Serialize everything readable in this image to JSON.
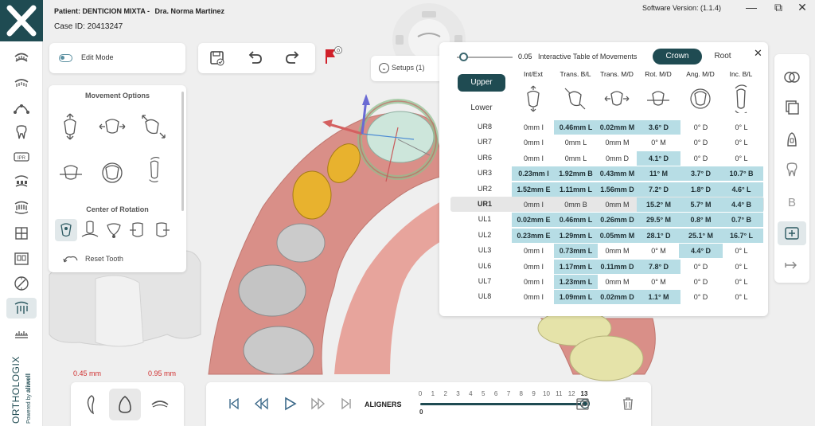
{
  "header": {
    "patient": "Patient: DENTICION MIXTA -",
    "doctor": "Dra. Norma Martinez",
    "case_id": "Case ID: 20413247",
    "software_version": "Software Version: (1.1.4)"
  },
  "window_controls": {
    "minimize": "—",
    "restore": "⧉",
    "close": "✕"
  },
  "edit_mode": {
    "label": "Edit Mode"
  },
  "flag_badge": "0",
  "setups": {
    "label": "Setups (1)"
  },
  "movement_panel": {
    "title": "Movement Options",
    "center_title": "Center of Rotation",
    "reset_label": "Reset Tooth"
  },
  "table": {
    "slider_value": "0.05",
    "title": "Interactive Table of Movements",
    "crown_label": "Crown",
    "root_label": "Root",
    "upper_label": "Upper",
    "lower_label": "Lower",
    "columns": [
      "Int/Ext",
      "Trans. B/L",
      "Trans. M/D",
      "Rot. M/D",
      "Ang. M/D",
      "Inc. B/L"
    ],
    "rows": [
      {
        "tooth": "UR8",
        "cells": [
          "0mm I",
          "0.46mm L",
          "0.02mm M",
          "3.6° D",
          "0° D",
          "0° L"
        ],
        "hl": [
          false,
          true,
          true,
          true,
          false,
          false
        ]
      },
      {
        "tooth": "UR7",
        "cells": [
          "0mm I",
          "0mm L",
          "0mm M",
          "0° M",
          "0° D",
          "0° L"
        ],
        "hl": [
          false,
          false,
          false,
          false,
          false,
          false
        ]
      },
      {
        "tooth": "UR6",
        "cells": [
          "0mm I",
          "0mm L",
          "0mm D",
          "4.1° D",
          "0° D",
          "0° L"
        ],
        "hl": [
          false,
          false,
          false,
          true,
          false,
          false
        ]
      },
      {
        "tooth": "UR3",
        "cells": [
          "0.23mm I",
          "1.92mm B",
          "0.43mm M",
          "11° M",
          "3.7° D",
          "10.7° B"
        ],
        "hl": [
          true,
          true,
          true,
          true,
          true,
          true
        ]
      },
      {
        "tooth": "UR2",
        "cells": [
          "1.52mm E",
          "1.11mm L",
          "1.56mm D",
          "7.2° D",
          "1.8° D",
          "4.6° L"
        ],
        "hl": [
          true,
          true,
          true,
          true,
          true,
          true
        ]
      },
      {
        "tooth": "UR1",
        "cells": [
          "0mm I",
          "0mm B",
          "0mm M",
          "15.2° M",
          "5.7° M",
          "4.4° B"
        ],
        "hl": [
          false,
          false,
          false,
          true,
          true,
          true
        ],
        "selected": true
      },
      {
        "tooth": "UL1",
        "cells": [
          "0.02mm E",
          "0.46mm L",
          "0.26mm D",
          "29.5° M",
          "0.8° M",
          "0.7° B"
        ],
        "hl": [
          true,
          true,
          true,
          true,
          true,
          true
        ]
      },
      {
        "tooth": "UL2",
        "cells": [
          "0.23mm E",
          "1.29mm L",
          "0.05mm M",
          "28.1° D",
          "25.1° M",
          "16.7° L"
        ],
        "hl": [
          true,
          true,
          true,
          true,
          true,
          true
        ]
      },
      {
        "tooth": "UL3",
        "cells": [
          "0mm I",
          "0.73mm L",
          "0mm M",
          "0° M",
          "4.4° D",
          "0° L"
        ],
        "hl": [
          false,
          true,
          false,
          false,
          true,
          false
        ]
      },
      {
        "tooth": "UL6",
        "cells": [
          "0mm I",
          "1.17mm L",
          "0.11mm D",
          "7.8° D",
          "0° D",
          "0° L"
        ],
        "hl": [
          false,
          true,
          true,
          true,
          false,
          false
        ]
      },
      {
        "tooth": "UL7",
        "cells": [
          "0mm I",
          "1.23mm L",
          "0mm M",
          "0° M",
          "0° D",
          "0° L"
        ],
        "hl": [
          false,
          true,
          false,
          false,
          false,
          false
        ]
      },
      {
        "tooth": "UL8",
        "cells": [
          "0mm I",
          "1.09mm L",
          "0.02mm D",
          "1.1° M",
          "0° D",
          "0° L"
        ],
        "hl": [
          false,
          true,
          true,
          true,
          false,
          false
        ]
      }
    ]
  },
  "measurements": {
    "left": "0.45 mm",
    "right": "0.95 mm"
  },
  "timeline": {
    "label": "ALIGNERS",
    "stages": [
      "0",
      "1",
      "2",
      "3",
      "4",
      "5",
      "6",
      "7",
      "8",
      "9",
      "10",
      "11",
      "12",
      "13"
    ],
    "current": "13",
    "start": "0",
    "progress": 1.0
  },
  "brand": {
    "name": "ORTHOLOGIX",
    "powered": "Powered by aliwell"
  },
  "colors": {
    "brand_teal": "#1f4b52",
    "highlight": "#b7dde5",
    "gum": "#d98f88",
    "selected_tooth": "#e8b22e",
    "measure_red": "#d03030"
  }
}
